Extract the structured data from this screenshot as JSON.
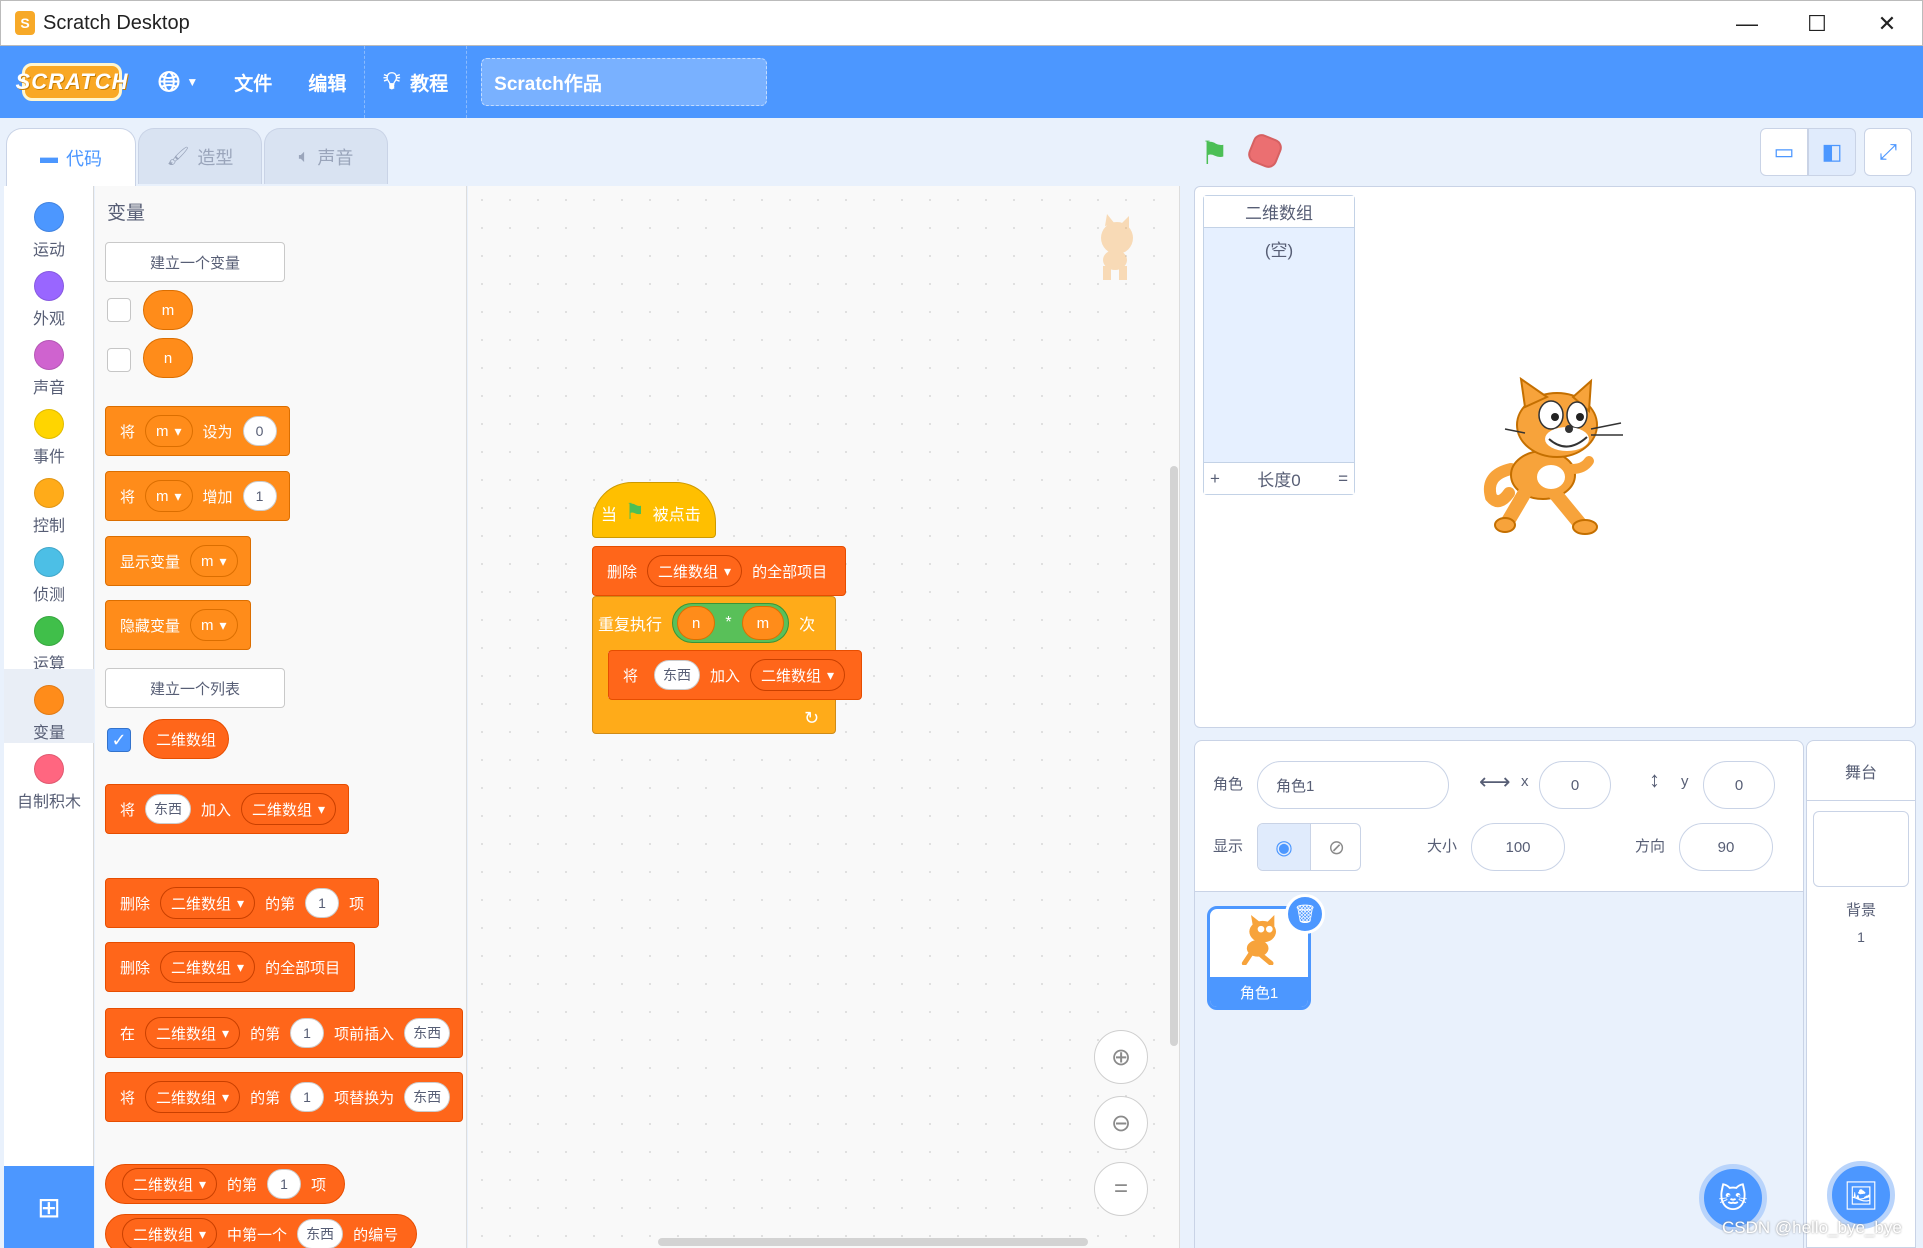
{
  "window": {
    "title": "Scratch Desktop",
    "minimize": "—",
    "maximize": "☐",
    "close": "✕"
  },
  "menubar": {
    "logo": "SCRATCH",
    "file": "文件",
    "edit": "编辑",
    "tutorials": "教程",
    "project_title": "Scratch作品"
  },
  "tabs": {
    "code": "代码",
    "costumes": "造型",
    "sounds": "声音"
  },
  "categories": [
    {
      "label": "运动",
      "color": "#4c97ff"
    },
    {
      "label": "外观",
      "color": "#9966ff"
    },
    {
      "label": "声音",
      "color": "#cf63cf"
    },
    {
      "label": "事件",
      "color": "#ffd500"
    },
    {
      "label": "控制",
      "color": "#ffab19"
    },
    {
      "label": "侦测",
      "color": "#4cbfe6"
    },
    {
      "label": "运算",
      "color": "#40bf4a"
    },
    {
      "label": "变量",
      "color": "#ff8c1a"
    },
    {
      "label": "自制积木",
      "color": "#ff6680"
    }
  ],
  "palette": {
    "heading": "变量",
    "make_variable": "建立一个变量",
    "make_list": "建立一个列表",
    "var_m": "m",
    "var_n": "n",
    "list_name": "二维数组",
    "set_block": {
      "w1": "将",
      "var": "m",
      "w2": "设为",
      "val": "0"
    },
    "change_block": {
      "w1": "将",
      "var": "m",
      "w2": "增加",
      "val": "1"
    },
    "show_var": {
      "w1": "显示变量",
      "var": "m"
    },
    "hide_var": {
      "w1": "隐藏变量",
      "var": "m"
    },
    "add_to_list": {
      "w1": "将",
      "val": "东西",
      "w2": "加入",
      "list": "二维数组"
    },
    "delete_item": {
      "w1": "删除",
      "list": "二维数组",
      "w2": "的第",
      "val": "1",
      "w3": "项"
    },
    "delete_all": {
      "w1": "删除",
      "list": "二维数组",
      "w2": "的全部项目"
    },
    "insert_item": {
      "w1": "在",
      "list": "二维数组",
      "w2": "的第",
      "val": "1",
      "w3": "项前插入",
      "val2": "东西"
    },
    "replace_item": {
      "w1": "将",
      "list": "二维数组",
      "w2": "的第",
      "val": "1",
      "w3": "项替换为",
      "val2": "东西"
    },
    "item_of": {
      "list": "二维数组",
      "w1": "的第",
      "val": "1",
      "w2": "项"
    },
    "index_of": {
      "list": "二维数组",
      "w1": "中第一个",
      "val": "东西",
      "w2": "的编号"
    }
  },
  "script": {
    "hat": {
      "w1": "当",
      "w2": "被点击"
    },
    "delete_all": {
      "w1": "删除",
      "list": "二维数组",
      "w2": "的全部项目"
    },
    "repeat": {
      "w1": "重复执行",
      "a": "n",
      "op": "*",
      "b": "m",
      "w2": "次"
    },
    "add": {
      "w1": "将",
      "val": "东西",
      "w2": "加入",
      "list": "二维数组"
    }
  },
  "stage": {
    "list_monitor": {
      "title": "二维数组",
      "empty": "(空)",
      "plus": "+",
      "length": "长度0",
      "eq": "="
    }
  },
  "sprite_info": {
    "sprite_label": "角色",
    "sprite_name": "角色1",
    "x_label": "x",
    "x_value": "0",
    "y_label": "y",
    "y_value": "0",
    "show_label": "显示",
    "size_label": "大小",
    "size_value": "100",
    "direction_label": "方向",
    "direction_value": "90",
    "thumb_name": "角色1"
  },
  "stage_pane": {
    "title": "舞台",
    "backdrop_label": "背景",
    "backdrop_count": "1"
  },
  "watermark": "CSDN @hello_bye_bye"
}
